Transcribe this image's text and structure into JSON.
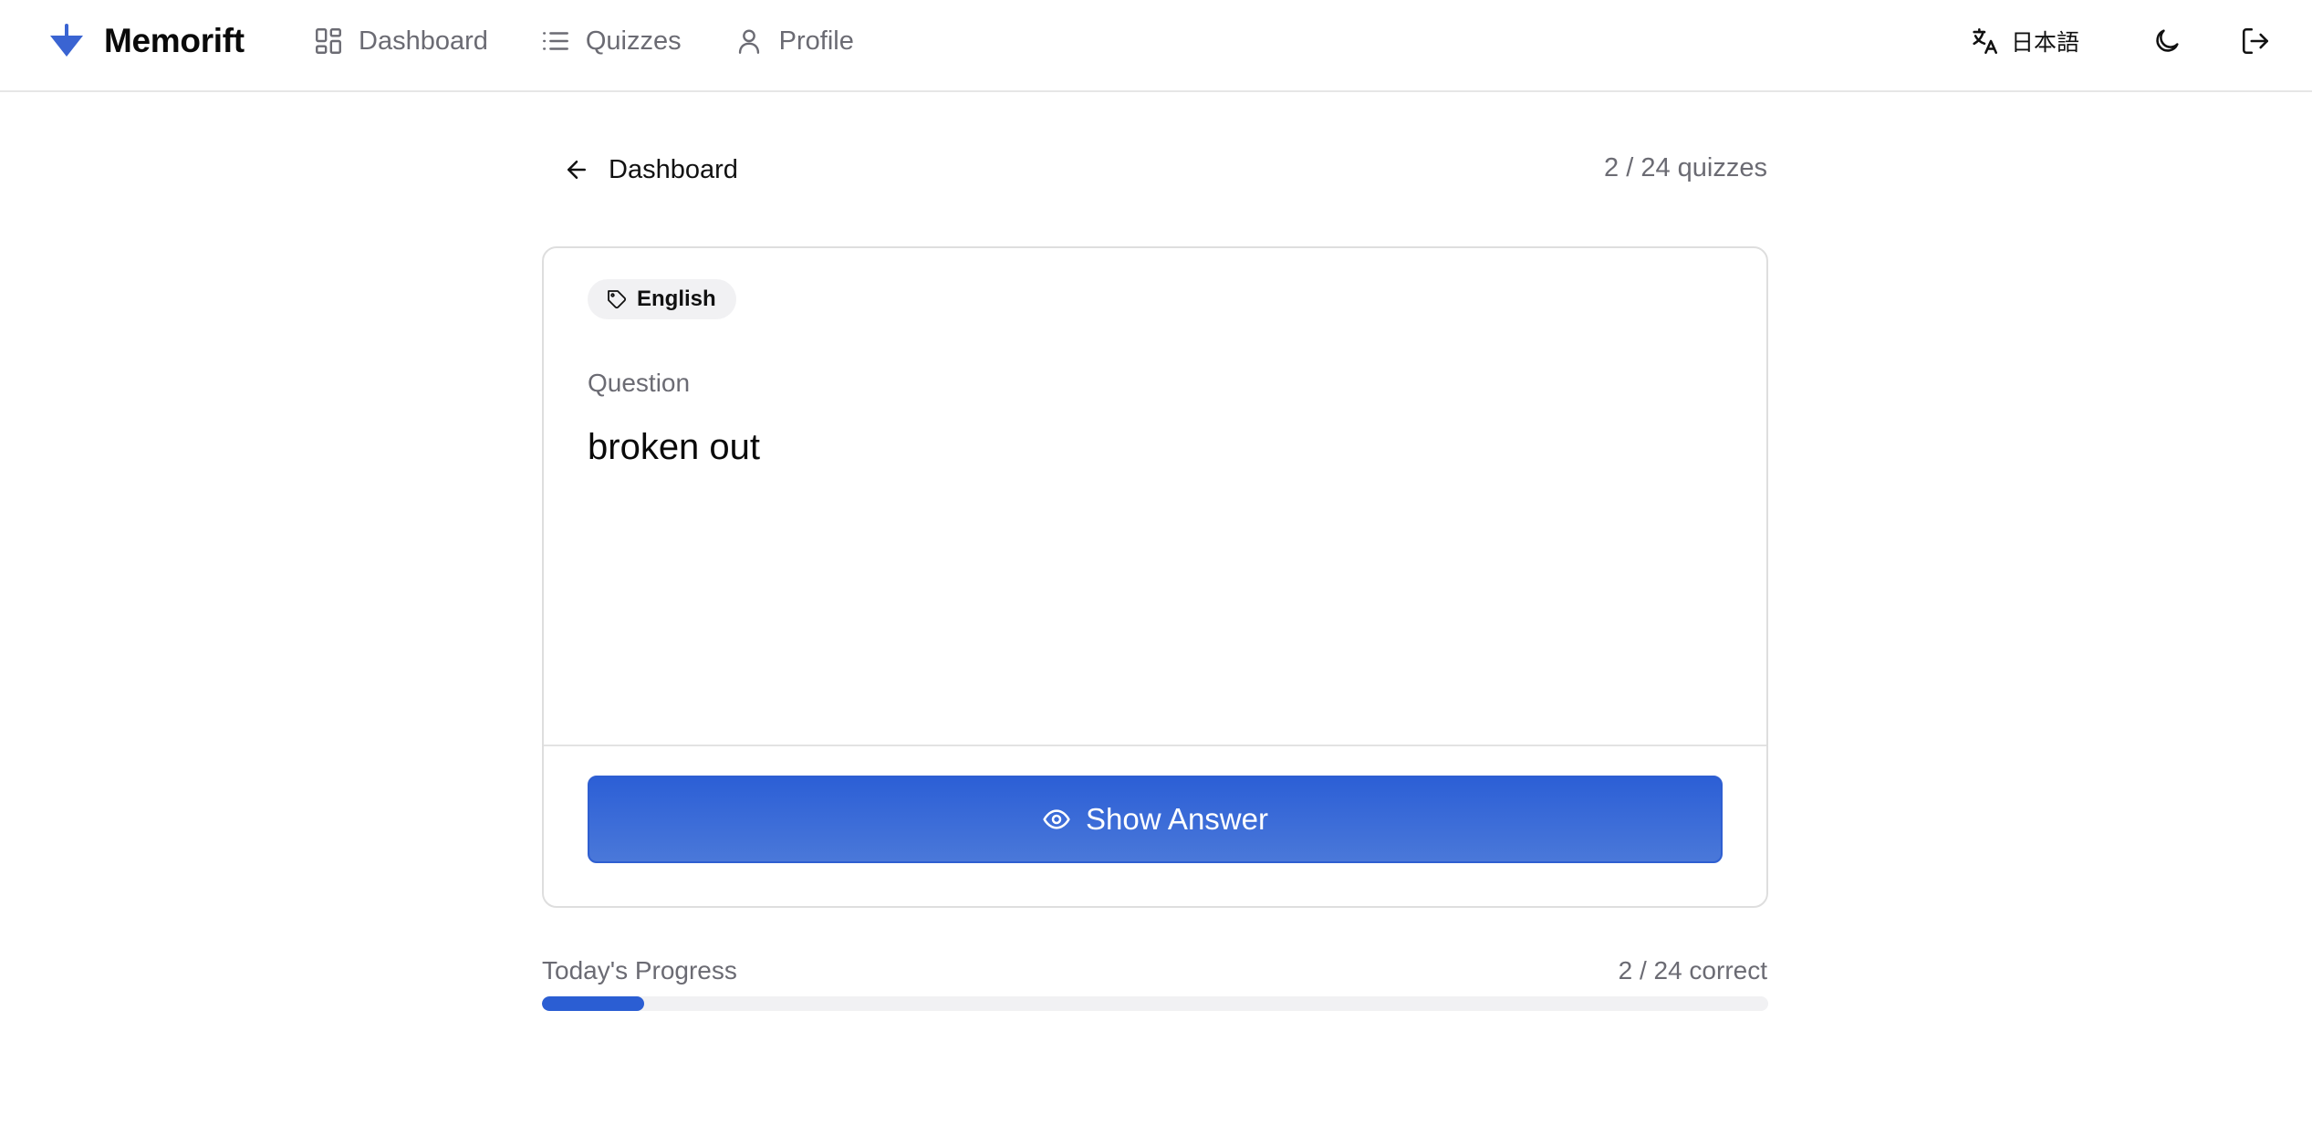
{
  "app": {
    "name": "Memorift",
    "brand_color": "#3a64d2"
  },
  "nav": {
    "items": [
      {
        "label": "Dashboard",
        "icon": "dashboard-grid-icon"
      },
      {
        "label": "Quizzes",
        "icon": "list-icon"
      },
      {
        "label": "Profile",
        "icon": "user-icon"
      }
    ]
  },
  "header_actions": {
    "language_label": "日本語",
    "language_icon": "translate-icon",
    "theme_icon": "moon-icon",
    "logout_icon": "logout-icon"
  },
  "subheader": {
    "back_label": "Dashboard",
    "quiz_count": "2 / 24 quizzes"
  },
  "card": {
    "tag_label": "English",
    "question_label": "Question",
    "question_text": "broken out",
    "show_answer_label": "Show Answer",
    "accent_color": "#2c5fd6"
  },
  "progress": {
    "label": "Today's Progress",
    "count_text": "2 / 24 correct",
    "correct": 2,
    "total": 24
  }
}
